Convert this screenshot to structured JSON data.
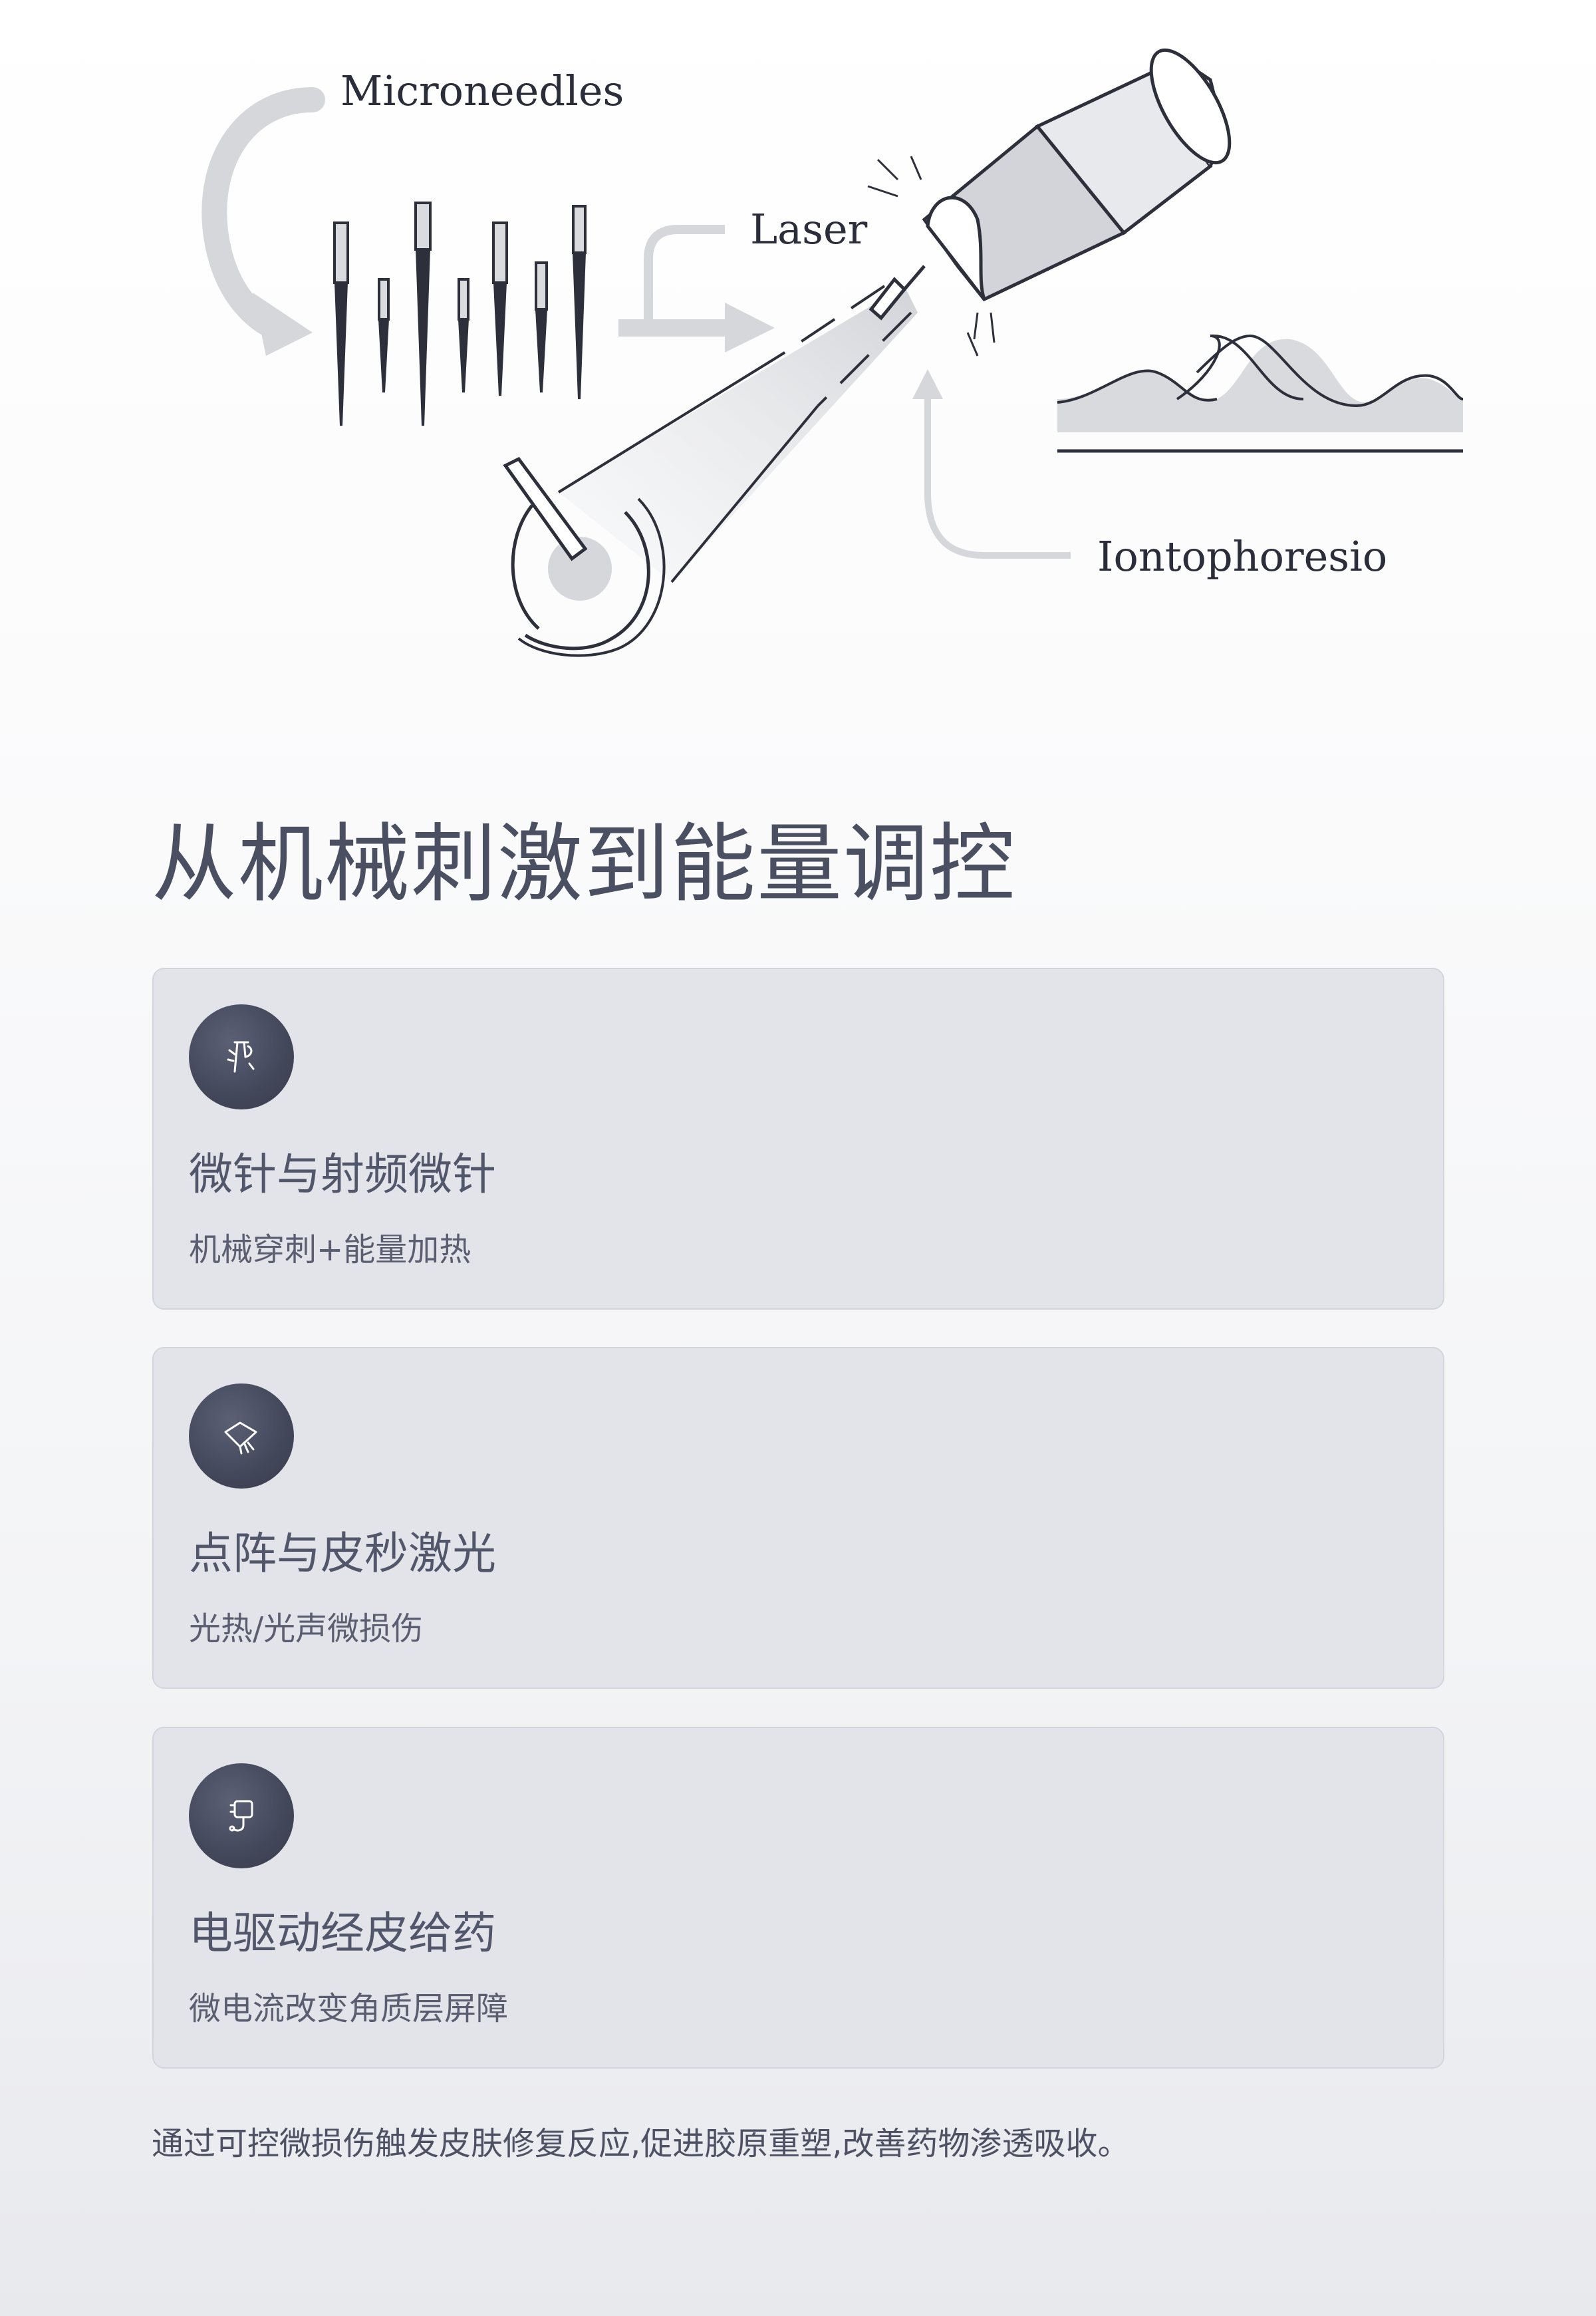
{
  "illustration": {
    "labels": {
      "microneedles": "Microneedles",
      "laser": "Laser",
      "iontophoresis": "Iontophoresio"
    }
  },
  "page": {
    "title": "从机械刺激到能量调控"
  },
  "cards": [
    {
      "icon": "microneedle-icon",
      "title": "微针与射频微针",
      "description": "机械穿刺+能量加热"
    },
    {
      "icon": "laser-icon",
      "title": "点阵与皮秒激光",
      "description": "光热/光声微损伤"
    },
    {
      "icon": "electric-plug-icon",
      "title": "电驱动经皮给药",
      "description": "微电流改变角质层屏障"
    }
  ],
  "footer": {
    "text": "通过可控微损伤触发皮肤修复反应,促进胶原重塑,改善药物渗透吸收。"
  },
  "colors": {
    "card_background": "#e3e4e9",
    "icon_circle": "#43475a",
    "title_text": "#4a4f61",
    "diagram_gray": "#d6d8dc"
  }
}
